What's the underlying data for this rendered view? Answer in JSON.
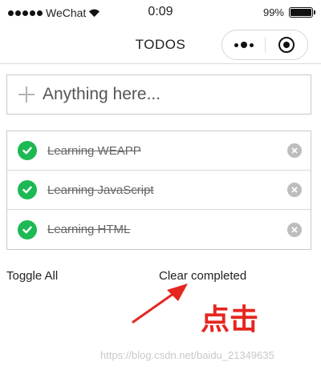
{
  "status_bar": {
    "carrier": "WeChat",
    "time": "0:09",
    "battery": "99%",
    "battery_level": 0.99
  },
  "nav": {
    "title": "TODOS",
    "more_icon": "more-dots-icon",
    "close_icon": "capsule-close-icon"
  },
  "input": {
    "placeholder": "Anything here..."
  },
  "todos": [
    {
      "text": "Learning WEAPP",
      "completed": true
    },
    {
      "text": "Learning JavaScript",
      "completed": true
    },
    {
      "text": "Learning HTML",
      "completed": true
    }
  ],
  "footer": {
    "toggle_all": "Toggle All",
    "clear_completed": "Clear completed"
  },
  "annotation": {
    "text": "点击",
    "color": "#e5261f"
  },
  "watermark": "https://blog.csdn.net/baidu_21349635",
  "colors": {
    "check": "#1db954",
    "delete": "#bdbdbd"
  }
}
